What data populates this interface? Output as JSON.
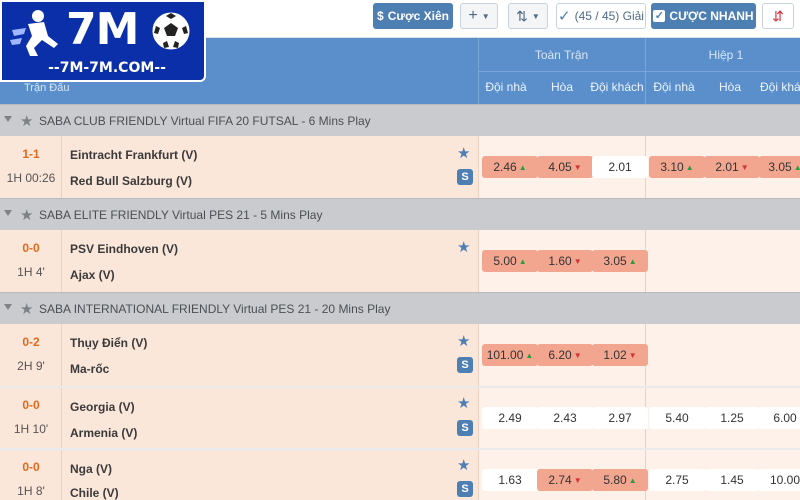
{
  "brand": {
    "logo_text": "7M",
    "logo_url": "--7M-7M.COM--"
  },
  "toolbar": {
    "parlay_label": "Cược Xiên",
    "add_label": "+",
    "sort_label": "⇅",
    "count_label": "(45 / 45) Giải",
    "quick_bet_label": "CƯỢC NHANH",
    "more_label": "⇵"
  },
  "header": {
    "match_label": "Trận Đấu",
    "full_time_label": "Toàn Trận",
    "first_half_label": "Hiệp 1",
    "cols": [
      "Đội nhà",
      "Hòa",
      "Đội khách",
      "Đội nhà",
      "Hòa",
      "Đội khách"
    ]
  },
  "leagues": [
    {
      "name": "SABA CLUB FRIENDLY Virtual FIFA 20 FUTSAL - 6 Mins Play",
      "matches": [
        {
          "score": "1-1",
          "time": "1H 00:26",
          "home": "Eintracht Frankfurt (V)",
          "away": "Red Bull Salzburg (V)",
          "odds": [
            {
              "v": "2.46",
              "d": "up"
            },
            {
              "v": "4.05",
              "d": "down"
            },
            {
              "v": "2.01",
              "d": ""
            },
            {
              "v": "3.10",
              "d": "up"
            },
            {
              "v": "2.01",
              "d": "down"
            },
            {
              "v": "3.05",
              "d": "up"
            }
          ]
        }
      ]
    },
    {
      "name": "SABA ELITE FRIENDLY Virtual PES 21 - 5 Mins Play",
      "matches": [
        {
          "score": "0-0",
          "time": "1H 4'",
          "home": "PSV Eindhoven (V)",
          "away": "Ajax (V)",
          "odds": [
            {
              "v": "5.00",
              "d": "up"
            },
            {
              "v": "1.60",
              "d": "down"
            },
            {
              "v": "3.05",
              "d": "up"
            }
          ]
        }
      ]
    },
    {
      "name": "SABA INTERNATIONAL FRIENDLY Virtual PES 21 - 20 Mins Play",
      "matches": [
        {
          "score": "0-2",
          "time": "2H 9'",
          "home": "Thụy Điển (V)",
          "away": "Ma-rốc",
          "odds": [
            {
              "v": "101.00",
              "d": "up"
            },
            {
              "v": "6.20",
              "d": "down"
            },
            {
              "v": "1.02",
              "d": "down"
            }
          ]
        },
        {
          "score": "0-0",
          "time": "1H 10'",
          "home": "Georgia (V)",
          "away": "Armenia (V)",
          "odds": [
            {
              "v": "2.49",
              "d": ""
            },
            {
              "v": "2.43",
              "d": ""
            },
            {
              "v": "2.97",
              "d": ""
            },
            {
              "v": "5.40",
              "d": ""
            },
            {
              "v": "1.25",
              "d": ""
            },
            {
              "v": "6.00",
              "d": ""
            }
          ]
        },
        {
          "score": "0-0",
          "time": "1H 8'",
          "home": "Nga (V)",
          "away": "Chile (V)",
          "odds": [
            {
              "v": "1.63",
              "d": ""
            },
            {
              "v": "2.74",
              "d": "down"
            },
            {
              "v": "5.80",
              "d": "up"
            },
            {
              "v": "2.75",
              "d": ""
            },
            {
              "v": "1.45",
              "d": ""
            },
            {
              "v": "10.00",
              "d": ""
            }
          ]
        }
      ]
    }
  ],
  "colors": {
    "header_blue": "#5a8fcb",
    "row_peach": "#fbe6da",
    "odds_highlight": "#f2a68f",
    "up": "#2f9a3e",
    "down": "#d2333a",
    "score": "#e06a1e"
  }
}
